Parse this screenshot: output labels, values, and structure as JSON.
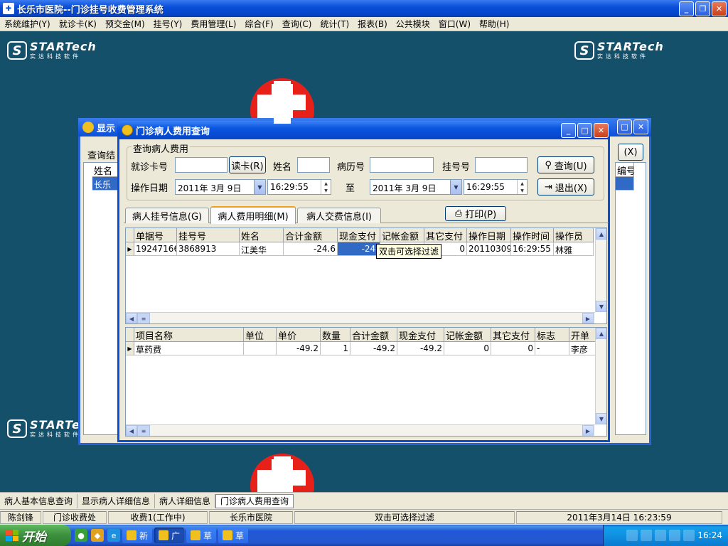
{
  "window": {
    "title": "长乐市医院--门诊挂号收费管理系统",
    "app_icon": "hospital-icon"
  },
  "menu": [
    "系统维护(Y)",
    "就诊卡(K)",
    "预交金(M)",
    "挂号(Y)",
    "费用管理(L)",
    "综合(F)",
    "查询(C)",
    "统计(T)",
    "报表(B)",
    "公共模块",
    "窗口(W)",
    "帮助(H)"
  ],
  "logo": {
    "main": "STARTech",
    "sub": "实达科技软件",
    "mark": "S"
  },
  "background_window": {
    "title_partial": "显示",
    "label_partial": "查询结",
    "col_partial": "姓名",
    "cell_partial": "长乐",
    "right_col_partial": "编号",
    "right_btn": "(X)"
  },
  "dialog": {
    "title": "门诊病人费用查询",
    "group_title": "查询病人费用",
    "fields": {
      "card_label": "就诊卡号",
      "card_value": "",
      "read_card_btn": "读卡(R)",
      "name_label": "姓名",
      "name_value": "",
      "record_label": "病历号",
      "record_value": "",
      "reg_label": "挂号号",
      "reg_value": "",
      "date_label": "操作日期",
      "date_from": "2011年 3月 9日",
      "time_from": "16:29:55",
      "to_label": "至",
      "date_to": "2011年 3月 9日",
      "time_to": "16:29:55"
    },
    "query_btn": "查询(U)",
    "exit_btn": "退出(X)",
    "tabs": [
      "病人挂号信息(G)",
      "病人费用明细(M)",
      "病人交费信息(I)"
    ],
    "active_tab": 1,
    "print_btn": "打印(P)",
    "grid1": {
      "columns": [
        "单据号",
        "挂号号",
        "姓名",
        "合计金额",
        "现金支付",
        "记帐金额",
        "其它支付",
        "操作日期",
        "操作时间",
        "操作员"
      ],
      "rows": [
        [
          "19247166",
          "3868913",
          "江美华",
          "-24.6",
          "-24.",
          "",
          "0",
          "20110309",
          "16:29:55",
          "林雅"
        ]
      ],
      "tooltip": "双击可选择过滤"
    },
    "grid2": {
      "columns": [
        "项目名称",
        "单位",
        "单价",
        "数量",
        "合计金额",
        "现金支付",
        "记帐金额",
        "其它支付",
        "标志",
        "开单"
      ],
      "rows": [
        [
          "草药费",
          "",
          "-49.2",
          "1",
          "-49.2",
          "-49.2",
          "0",
          "0",
          "-",
          "李彦"
        ]
      ]
    }
  },
  "window_tabs": [
    "病人基本信息查询",
    "显示病人详细信息",
    "病人详细信息",
    "门诊病人费用查询"
  ],
  "active_window_tab": 3,
  "status": {
    "user": "陈剑锋",
    "dept": "门诊收费处",
    "station": "收费1(工作中)",
    "hospital": "长乐市医院",
    "hint": "双击可选择过滤",
    "datetime": "2011年3月14日 16:23:59"
  },
  "taskbar": {
    "start": "开始",
    "tasks": [
      "新",
      "广",
      "草",
      "草"
    ],
    "active_task": 1,
    "clock": "16:24"
  },
  "colors": {
    "title_blue": "#0a4fd8",
    "desktop": "#14506a",
    "taskbar_green": "#3c8f3c"
  }
}
